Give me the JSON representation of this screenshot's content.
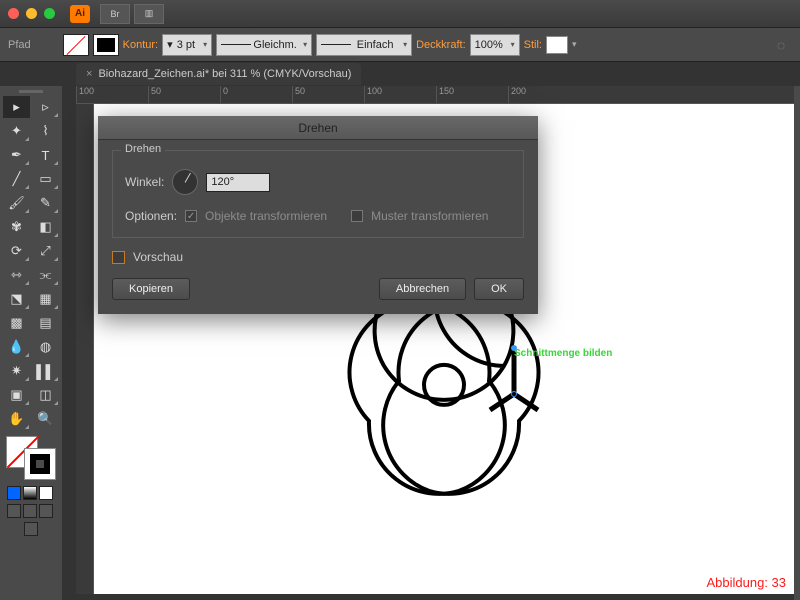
{
  "titlebar": {
    "app_abbrev": "Ai",
    "br_label": "Br"
  },
  "controlbar": {
    "path_label": "Pfad",
    "kontur_label": "Kontur:",
    "stroke_weight": "3 pt",
    "cap_label": "Gleichm.",
    "brush_label": "Einfach",
    "opacity_label": "Deckkraft:",
    "opacity_value": "100%",
    "style_label": "Stil:"
  },
  "tab": {
    "close": "×",
    "title": "Biohazard_Zeichen.ai* bei 311 % (CMYK/Vorschau)"
  },
  "ruler": {
    "m100": "100",
    "m50": "50",
    "z": "0",
    "p50": "50",
    "p100": "100",
    "p150": "150",
    "p200": "200"
  },
  "canvas": {
    "hint_text": "Schnittmenge bilden",
    "figure_label": "Abbildung: 33"
  },
  "dialog": {
    "title": "Drehen",
    "section": "Drehen",
    "angle_label": "Winkel:",
    "angle_value": "120°",
    "options_label": "Optionen:",
    "opt_objects": "Objekte transformieren",
    "opt_patterns": "Muster transformieren",
    "preview": "Vorschau",
    "copy": "Kopieren",
    "cancel": "Abbrechen",
    "ok": "OK"
  }
}
